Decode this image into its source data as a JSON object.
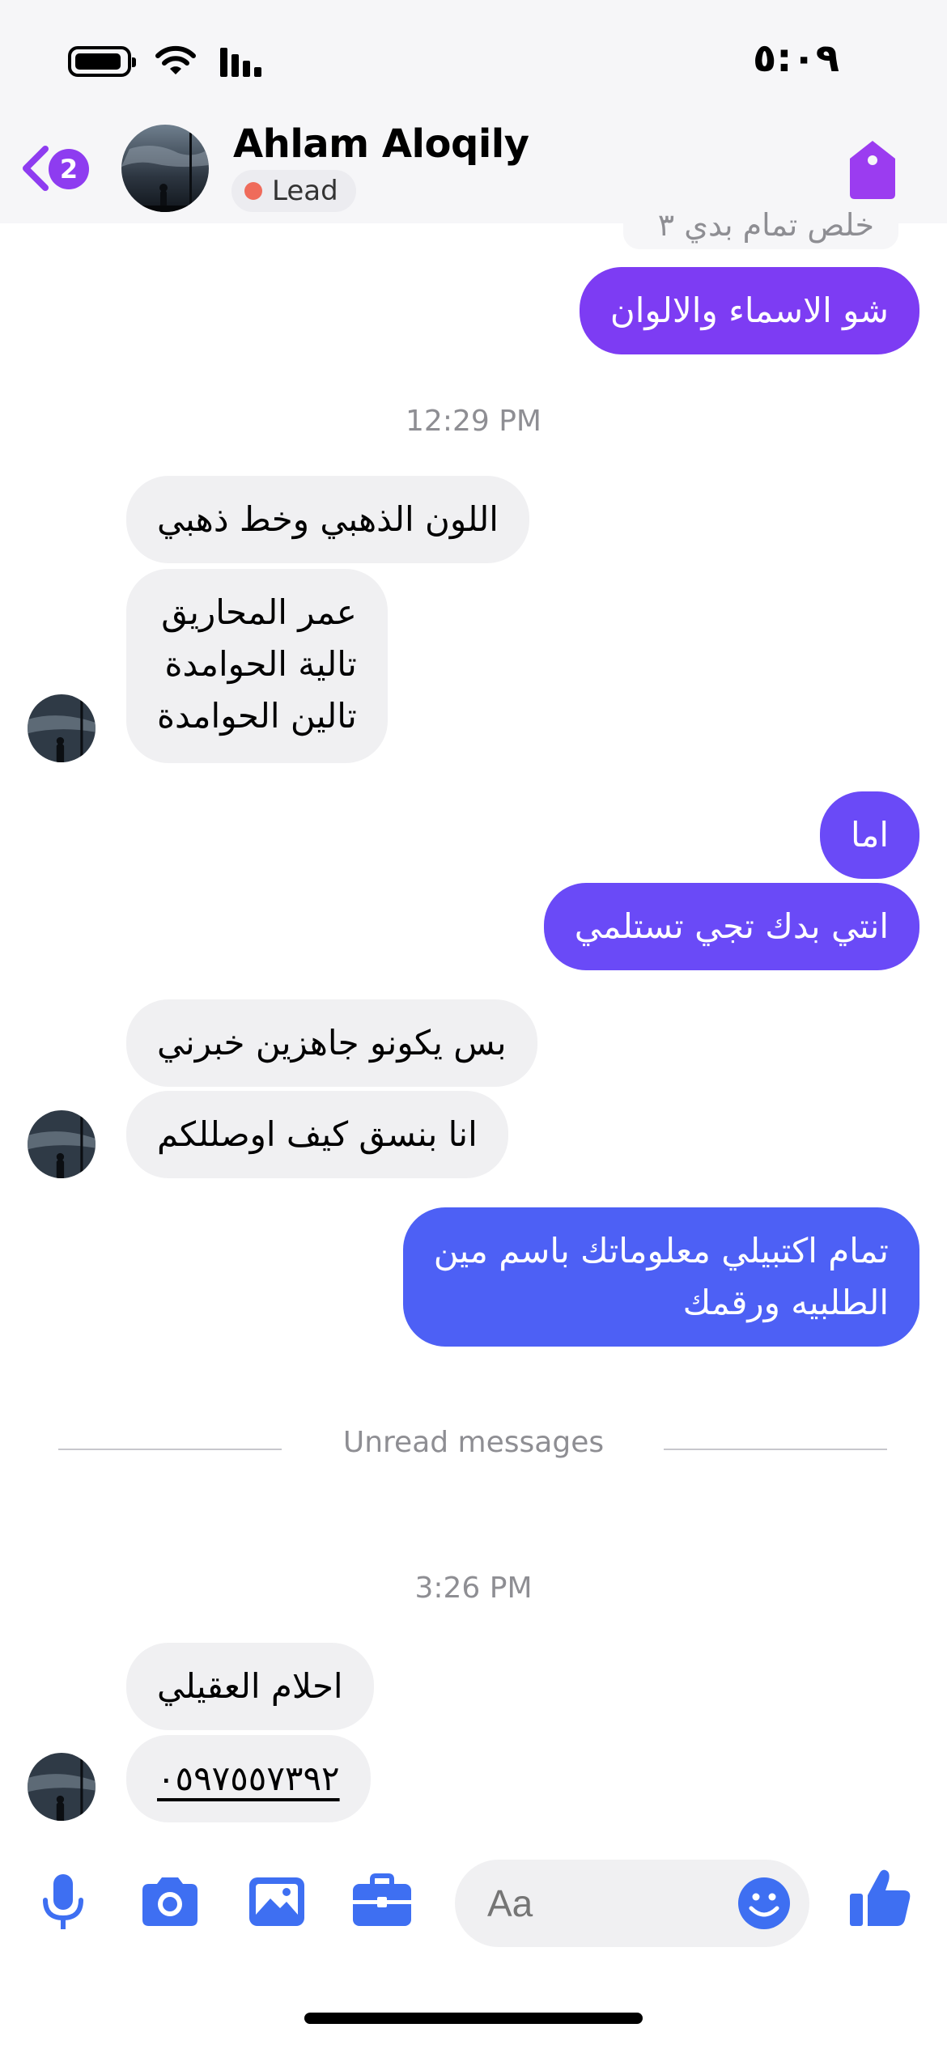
{
  "status_bar": {
    "time": "٥:٠٩"
  },
  "header": {
    "back_badge": "2",
    "contact_name": "Ahlam Aloqily",
    "lead_label": "Lead"
  },
  "conversation": {
    "partial_top": "خلص تمام بدي ٣",
    "m1": "شو الاسماء والالوان",
    "ts1": "12:29 PM",
    "m2": "اللون الذهبي وخط ذهبي",
    "m3": "عمر المحاريق\nتالية الحوامدة\nتالين الحوامدة",
    "m4": "اما",
    "m5": "انتي بدك تجي تستلمي",
    "m6": "بس يكونو جاهزين خبرني",
    "m7": "انا بنسق كيف اوصللكم",
    "m8": "تمام اكتبيلي معلوماتك باسم مين\nالطلبيه ورقمك",
    "unread": "Unread messages",
    "ts2": "3:26 PM",
    "m9": "احلام العقيلي",
    "m10": "٠٥٩٧٥٥٧٣٩٢"
  },
  "composer": {
    "placeholder": "Aa"
  },
  "colors": {
    "accent_purple": "#7d3cf3",
    "accent_blue": "#4d60f5",
    "icon_blue": "#3e6ff2",
    "bubble_gray": "#f0f0f2"
  }
}
